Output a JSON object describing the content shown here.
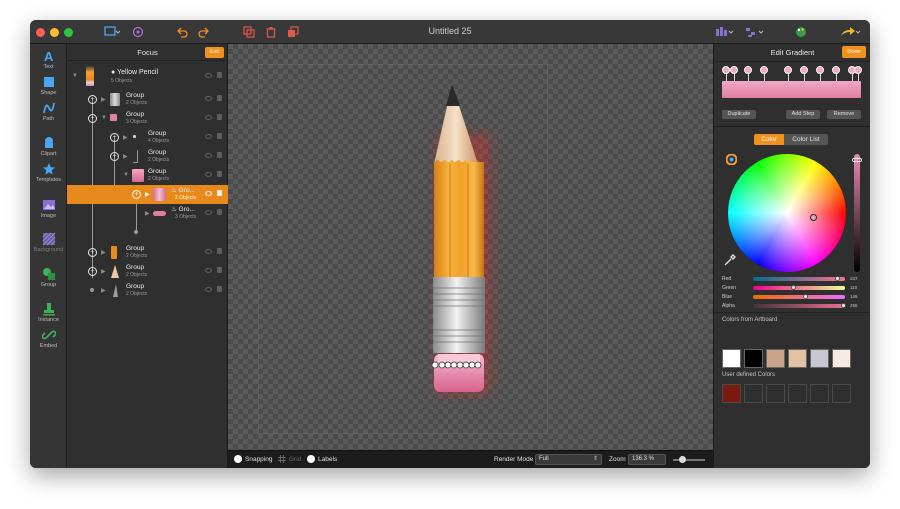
{
  "window": {
    "title": "Untitled 25"
  },
  "toolbar": {
    "tools": [
      {
        "label": "Text",
        "icon": "text-icon"
      },
      {
        "label": "Shape",
        "icon": "shape-icon"
      },
      {
        "label": "Path",
        "icon": "path-icon"
      },
      {
        "label": "Clipart",
        "icon": "clipart-icon"
      },
      {
        "label": "Templates",
        "icon": "templates-icon"
      },
      {
        "label": "Image",
        "icon": "image-icon"
      },
      {
        "label": "Background",
        "icon": "background-icon"
      },
      {
        "label": "Group",
        "icon": "group-icon"
      },
      {
        "label": "Instance",
        "icon": "instance-icon"
      },
      {
        "label": "Embed",
        "icon": "embed-icon"
      }
    ]
  },
  "focus": {
    "title": "Focus",
    "exit_label": "Exit",
    "rows": [
      {
        "name": "Yellow Pencil",
        "sub": "5 Objects"
      },
      {
        "name": "Group",
        "sub": "2 Objects"
      },
      {
        "name": "Group",
        "sub": "3 Objects"
      },
      {
        "name": "Group",
        "sub": "4 Objects"
      },
      {
        "name": "Group",
        "sub": "2 Objects"
      },
      {
        "name": "Group",
        "sub": "2 Objects"
      },
      {
        "name": "Gro...",
        "sub": "2 Objects"
      },
      {
        "name": "Gro...",
        "sub": "3 Objects"
      },
      {
        "name": "Group",
        "sub": "2 Objects"
      },
      {
        "name": "Group",
        "sub": "2 Objects"
      },
      {
        "name": "Group",
        "sub": "2 Objects"
      }
    ]
  },
  "statusbar": {
    "snapping": "Snapping",
    "grid": "Grid",
    "labels": "Labels",
    "render_mode_label": "Render Mode",
    "render_mode_value": "Full",
    "zoom_label": "Zoom",
    "zoom_value": "136.3 %"
  },
  "gradient_panel": {
    "title": "Edit Gradient",
    "done_label": "Done",
    "duplicate_label": "Duplicate",
    "add_step_label": "Add Step",
    "remove_label": "Remove",
    "tab_color": "Color",
    "tab_color_list": "Color List",
    "sliders": [
      {
        "label": "Red",
        "value": "237",
        "level": 0.93
      },
      {
        "label": "Green",
        "value": "110",
        "level": 0.43
      },
      {
        "label": "Blue",
        "value": "145",
        "level": 0.57
      },
      {
        "label": "Alpha",
        "value": "255",
        "level": 1.0
      }
    ],
    "artboard_colors_label": "Colors from Artboard",
    "artboard_colors": [
      "#ffffff",
      "#000000",
      "#c9a48a",
      "#e3c2a3",
      "#c7c7cf",
      "#f7ece4"
    ],
    "user_colors_label": "User defined Colors",
    "user_colors": [
      "#7a1a0e",
      "#2f2f2f",
      "#2f2f2f",
      "#2f2f2f",
      "#2f2f2f",
      "#2f2f2f"
    ]
  },
  "colors": {
    "accent": "#f0901e",
    "gradient_start": "#f0a8c2",
    "gradient_end": "#e27ea4"
  }
}
